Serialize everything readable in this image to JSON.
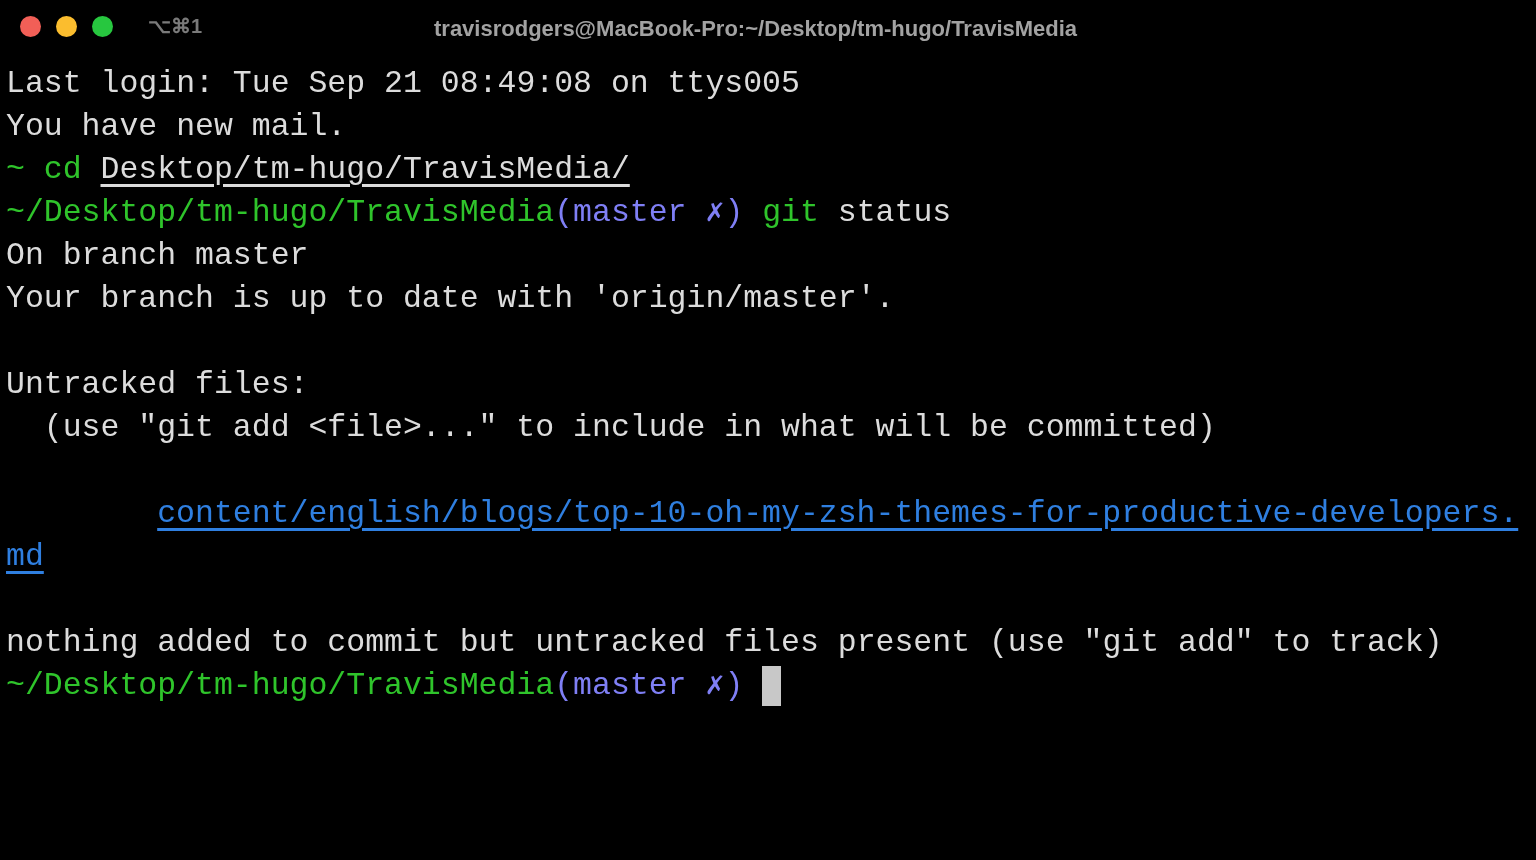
{
  "window": {
    "title": "travisrodgers@MacBook-Pro:~/Desktop/tm-hugo/TravisMedia",
    "shortcut": "⌥⌘1"
  },
  "lines": [
    {
      "kind": "text",
      "segments": [
        {
          "kind": "output",
          "text": "Last login: Tue Sep 21 08:49:08 on ttys005"
        }
      ]
    },
    {
      "kind": "text",
      "segments": [
        {
          "kind": "output",
          "text": "You have new mail."
        }
      ]
    },
    {
      "kind": "text",
      "segments": [
        {
          "kind": "prompt",
          "text": "~"
        },
        {
          "kind": "command",
          "text": "cd"
        },
        {
          "kind": "path",
          "text": "Desktop/tm-hugo/TravisMedia/"
        }
      ]
    },
    {
      "kind": "text",
      "segments": [
        {
          "kind": "prompt",
          "text": "~/Desktop/tm-hugo/TravisMedia"
        },
        {
          "kind": "branch",
          "text": "(master ✗)"
        },
        {
          "kind": "command",
          "text": "git"
        },
        {
          "kind": "output",
          "text": "status"
        }
      ]
    },
    {
      "kind": "text",
      "segments": [
        {
          "kind": "output",
          "text": "On branch master"
        }
      ]
    },
    {
      "kind": "text",
      "segments": [
        {
          "kind": "output",
          "text": "Your branch is up to date with 'origin/master'."
        }
      ]
    },
    {
      "kind": "blank"
    },
    {
      "kind": "text",
      "segments": [
        {
          "kind": "output",
          "text": "Untracked files:"
        }
      ]
    },
    {
      "kind": "hint",
      "segments": [
        {
          "kind": "output",
          "text": "(use \"git add <file>...\" to include in what will be committed)"
        }
      ]
    },
    {
      "kind": "blank"
    },
    {
      "kind": "file",
      "segments": [
        {
          "kind": "file",
          "text": "content/english/blogs/top-10-oh-my-zsh-themes-for-productive-developers."
        }
      ]
    },
    {
      "kind": "text",
      "segments": [
        {
          "kind": "file",
          "text": "md"
        }
      ]
    },
    {
      "kind": "blank"
    },
    {
      "kind": "text",
      "segments": [
        {
          "kind": "output",
          "text": "nothing added to commit but untracked files present (use \"git add\" to track)"
        }
      ]
    },
    {
      "kind": "text",
      "segments": [
        {
          "kind": "prompt",
          "text": "~/Desktop/tm-hugo/TravisMedia"
        },
        {
          "kind": "branch",
          "text": "(master ✗)"
        },
        {
          "kind": "cursor"
        }
      ]
    }
  ]
}
